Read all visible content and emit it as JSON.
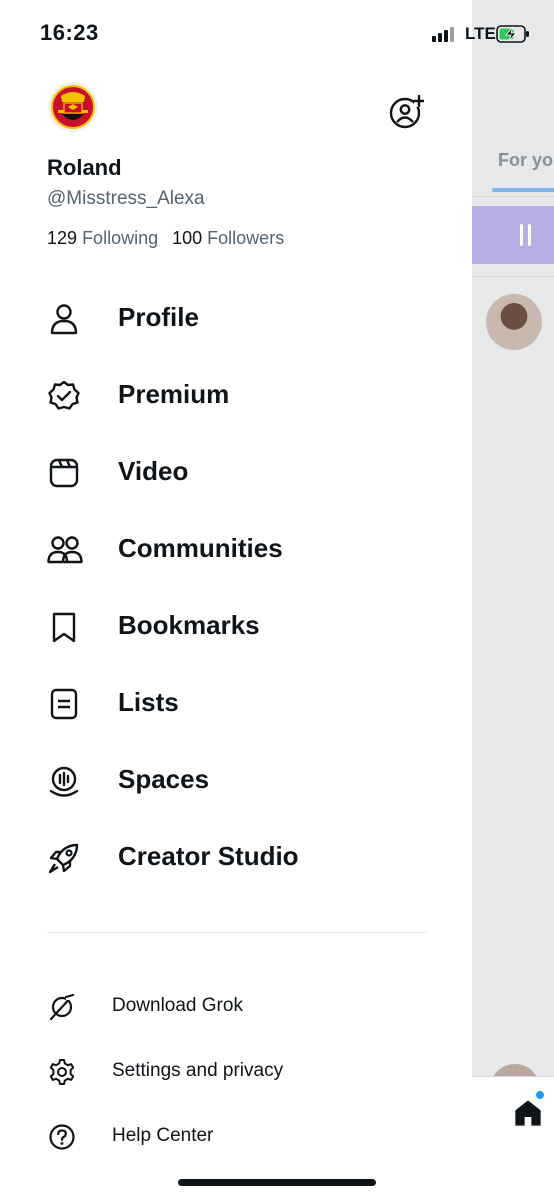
{
  "status_bar": {
    "time": "16:23",
    "network": "LTE",
    "battery_state": "charging"
  },
  "background_feed": {
    "tab_label": "For yo"
  },
  "account": {
    "display_name": "Roland",
    "handle": "@Misstress_Alexa",
    "following_count": "129",
    "following_label": "Following",
    "followers_count": "100",
    "followers_label": "Followers",
    "avatar_icon": "manchester-united-crest"
  },
  "menu": {
    "items": [
      {
        "label": "Profile",
        "icon": "person-icon"
      },
      {
        "label": "Premium",
        "icon": "verified-badge-icon"
      },
      {
        "label": "Video",
        "icon": "video-icon"
      },
      {
        "label": "Communities",
        "icon": "communities-icon"
      },
      {
        "label": "Bookmarks",
        "icon": "bookmark-icon"
      },
      {
        "label": "Lists",
        "icon": "list-icon"
      },
      {
        "label": "Spaces",
        "icon": "spaces-icon"
      },
      {
        "label": "Creator Studio",
        "icon": "rocket-icon"
      }
    ]
  },
  "secondary": {
    "items": [
      {
        "label": "Download Grok",
        "icon": "grok-icon"
      },
      {
        "label": "Settings and privacy",
        "icon": "gear-icon"
      },
      {
        "label": "Help Center",
        "icon": "help-icon"
      }
    ]
  },
  "colors": {
    "text": "#0f1419",
    "secondary_text": "#536471",
    "accent": "#1d9bf0",
    "spaces_pill": "#b8aee6"
  }
}
